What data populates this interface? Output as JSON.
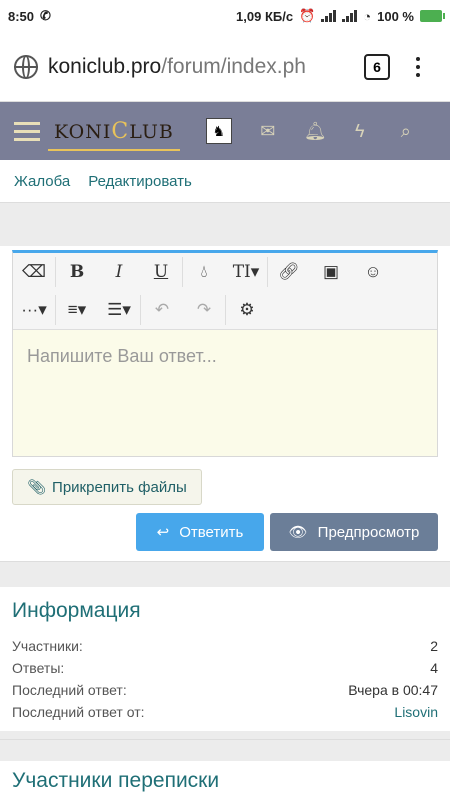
{
  "status": {
    "time": "8:50",
    "speed": "1,09 КБ/с",
    "battery": "100 %"
  },
  "browser": {
    "url_main": "koniclub.pro",
    "url_rest": "/forum/index.ph",
    "tab_count": "6"
  },
  "site": {
    "logo_left": "KONI",
    "logo_c": "C",
    "logo_right": "LUB"
  },
  "post_actions": {
    "report": "Жалоба",
    "edit": "Редактировать"
  },
  "editor": {
    "placeholder": "Напишите Ваш ответ...",
    "toolbar": [
      "eraser",
      "B",
      "I",
      "U",
      "drop",
      "TI",
      "link",
      "image",
      "smile",
      "more",
      "align",
      "list",
      "undo",
      "redo",
      "gear"
    ]
  },
  "buttons": {
    "attach": "Прикрепить файлы",
    "reply": "Ответить",
    "preview": "Предпросмотр"
  },
  "info": {
    "title": "Информация",
    "rows": [
      {
        "label": "Участники:",
        "value": "2"
      },
      {
        "label": "Ответы:",
        "value": "4"
      },
      {
        "label": "Последний ответ:",
        "value": "Вчера в 00:47"
      },
      {
        "label": "Последний ответ от:",
        "value": "Lisovin"
      }
    ]
  },
  "participants": {
    "title": "Участники переписки"
  }
}
